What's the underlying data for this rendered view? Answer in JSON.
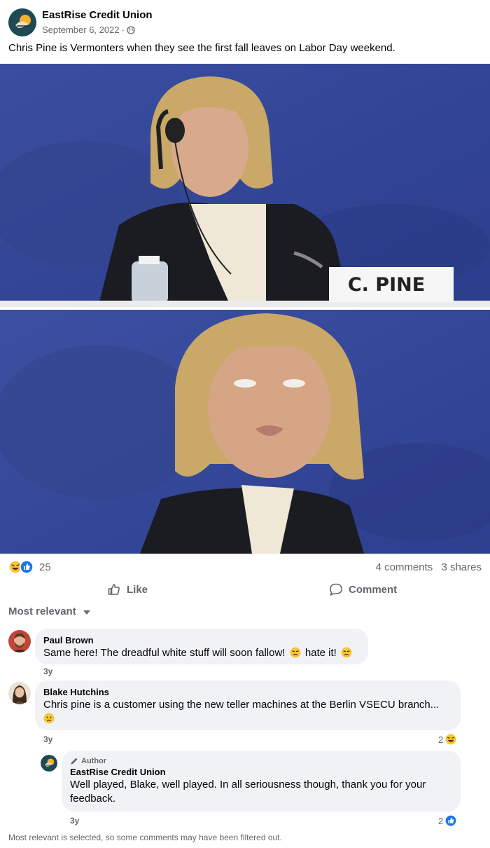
{
  "post": {
    "author": "EastRise Credit Union",
    "date": "September 6, 2022",
    "separator": "·",
    "caption": "Chris Pine is Vermonters when they see the first fall leaves on Labor Day weekend.",
    "photo_nameplate": "C. PINE"
  },
  "engagement": {
    "reaction_count": "25",
    "comments": "4 comments",
    "shares": "3 shares"
  },
  "actions": {
    "like_label": "Like",
    "comment_label": "Comment"
  },
  "sort": {
    "label": "Most relevant"
  },
  "comments": [
    {
      "name": "Paul Brown",
      "text_part1": "Same here! The dreadful white stuff will soon fallow!",
      "text_part2": "hate it!",
      "time": "3y"
    },
    {
      "name": "Blake Hutchins",
      "text": "Chris pine is a customer using the new teller machines at the Berlin VSECU branch...",
      "time": "3y",
      "reaction_count": "2"
    }
  ],
  "reply": {
    "tag": "Author",
    "name": "EastRise Credit Union",
    "text": "Well played, Blake, well played. In all seriousness though, thank you for your feedback.",
    "time": "3y",
    "reaction_count": "2"
  },
  "footer_note": "Most relevant is selected, so some comments may have been filtered out.",
  "colors": {
    "secondary_text": "#65676b",
    "bubble_bg": "#f0f2f5",
    "like_blue": "#1877f2",
    "emoji_yellow": "#f7c634"
  }
}
